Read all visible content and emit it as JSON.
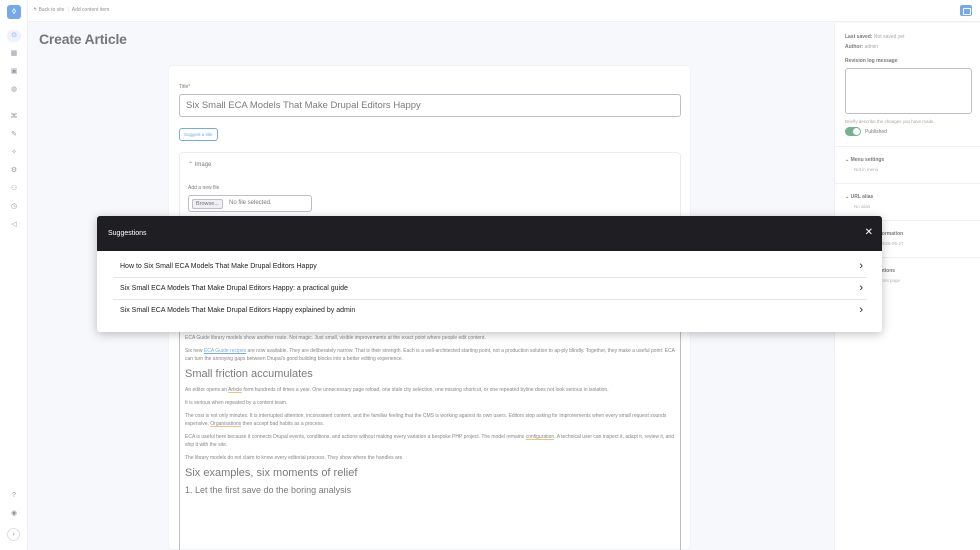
{
  "topbar": {
    "back_label": "Back to site",
    "add_label": "Add content item"
  },
  "page": {
    "title": "Create Article"
  },
  "form": {
    "title_label": "Title",
    "title_required": "*",
    "title_value": "Six Small ECA Models That Make Drupal Editors Happy",
    "suggest_label": "Suggest a title",
    "image_label": "Image",
    "add_file_label": "Add a new file",
    "browse_label": "Browse...",
    "no_file_label": "No file selected."
  },
  "body": {
    "p1": "ECA Guide library models show another route. Not magic. Just small, visible improvements at the exact point where people edit content.",
    "p2a": "Six new ",
    "p2_link": "ECA Guide recipes",
    "p2b": " are now available. They are deliberately narrow. That is their strength. Each is a well-architected starting point, not a production solution to ap-ply blindly. Together, they make a useful point: ECA can turn the annoying gaps between Drupal's good building blocks into a better editing experience.",
    "h_small_friction": "Small friction accumulates",
    "p3a": "An editor opens an ",
    "p3_link": "Article",
    "p3b": " form hundreds of times a year. One unnecessary page reload, one stale city selection, one missing shortcut, or one repeated byline does not look serious in isolation.",
    "p4": "It is serious when repeated by a content team.",
    "p5a": "The cost is not only minutes. It is interrupted attention, inconsistent content, and the familiar feeling that the CMS is working against its own users. Editors stop asking for improvements when every small request sounds expensive. ",
    "p5_spell": "Organisations",
    "p5b": " then accept bad habits as a process.",
    "p6a": "ECA is useful here because it connects Drupal events, conditions, and actions without making every variation a bespoke PHP project. The model remains ",
    "p6_spell": "configuration",
    "p6b": ". A technical user can inspect it, adapt it, review it, and ship it with the site.",
    "p7": "The library models do not claim to know every editorial process. They show where the handles are.",
    "h_six": "Six examples, six moments of relief",
    "h_first": "1. Let the first save do the boring analysis"
  },
  "sidebar": {
    "last_saved_label": "Last saved:",
    "last_saved_value": "Not saved yet",
    "author_label": "Author:",
    "author_value": "admin",
    "revision_label": "Revision log message",
    "revision_hint": "Briefly describe the changes you have made.",
    "published_label": "Published",
    "sections": [
      {
        "title": "Menu settings",
        "sub": "Not in menu"
      },
      {
        "title": "URL alias",
        "sub": "No alias"
      },
      {
        "title": "Authoring information",
        "sub": "admin (1) on 2026-05-27"
      },
      {
        "title": "Promotion options",
        "sub": "Promoted to front page"
      }
    ]
  },
  "dialog": {
    "title": "Suggestions",
    "items": [
      "How to Six Small ECA Models That Make Drupal Editors Happy",
      "Six Small ECA Models That Make Drupal Editors Happy: a practical guide",
      "Six Small ECA Models That Make Drupal Editors Happy explained by admin"
    ]
  },
  "icons": {
    "logo": "drupal-drop-icon",
    "close": "close-icon",
    "chevron": "chevron-right-icon"
  },
  "colors": {
    "accent": "#2c7be5",
    "dialog_header": "#1f1f23",
    "published_toggle": "#2c8a4c"
  }
}
